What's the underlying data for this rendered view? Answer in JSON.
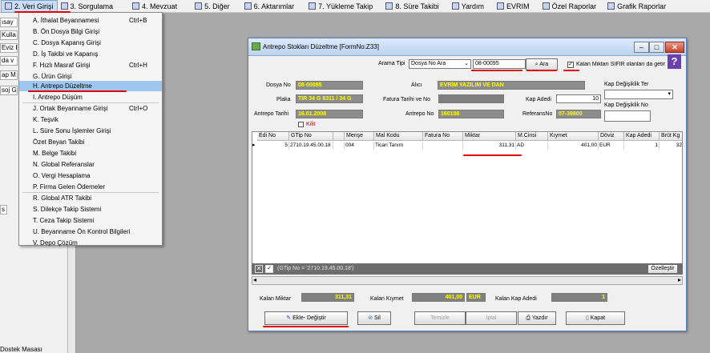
{
  "menubar": [
    {
      "label": "2.  Veri Girişi"
    },
    {
      "label": "3.  Sorgulama"
    },
    {
      "label": "4.  Mevzuat"
    },
    {
      "label": "5.  Diğer"
    },
    {
      "label": "6.  Aktarımlar"
    },
    {
      "label": "7.  Yükleme Takip"
    },
    {
      "label": "8. Süre Takibi"
    },
    {
      "label": "Yardım"
    },
    {
      "label": "EVRIM"
    },
    {
      "label": "Özel Raporlar"
    },
    {
      "label": "Grafik Raporlar"
    }
  ],
  "leftpanel": {
    "rows": [
      "ısay",
      "Kulla",
      "Eviz K",
      "da v",
      "ap M",
      "soj G"
    ],
    "stub1": "s",
    "bottom": "Dostek Masası"
  },
  "dropdown": [
    {
      "label": "A.  İthalat Beyannamesi",
      "shortcut": "Ctrl+B"
    },
    {
      "label": "B.  Ön Dosya Bilgi Girişi",
      "shortcut": ""
    },
    {
      "label": "C.  Dosya Kapanış Girişi",
      "shortcut": ""
    },
    {
      "label": "D.  İş Takibi ve Kapanış",
      "shortcut": ""
    },
    {
      "label": "F.  Hızlı Masraf Girişi",
      "shortcut": "Ctrl+H"
    },
    {
      "label": "G.  Ürün Girişi",
      "shortcut": ""
    },
    {
      "label": "H.  Antrepo Düzeltme",
      "shortcut": ""
    },
    {
      "label": "I.   Antrepo Düşüm",
      "shortcut": ""
    },
    {
      "label": "J.  Ortak Beyanname Girişi",
      "shortcut": "Ctrl+O"
    },
    {
      "label": "K.  Teşvik",
      "shortcut": ""
    },
    {
      "label": "L.   Süre Sonu İşlemler Girişi",
      "shortcut": ""
    },
    {
      "label": "      Özet Beyan Takibi",
      "shortcut": ""
    },
    {
      "label": "M.   Belge Takibi",
      "shortcut": ""
    },
    {
      "label": "N.  Global Referanslar",
      "shortcut": ""
    },
    {
      "label": "O. Vergi Hesaplama",
      "shortcut": ""
    },
    {
      "label": "P. Firma Gelen Ödemeler",
      "shortcut": ""
    },
    {
      "label": "R. Global ATR Takibi",
      "shortcut": ""
    },
    {
      "label": "S. Dilekçe Takip Sistemi",
      "shortcut": ""
    },
    {
      "label": "T. Ceza Takip Sistemi",
      "shortcut": ""
    },
    {
      "label": "U. Beyanname Ön Kontrol Bilgileri",
      "shortcut": ""
    },
    {
      "label": "V. Depo Çözüm",
      "shortcut": ""
    }
  ],
  "window": {
    "title": "Antrepo Stokları Düzeltme  [FormNo:Z33]",
    "arama_tipi_label": "Arama Tipi",
    "arama_tipi_value": "Dosya No Ara",
    "search_value": "08-00095",
    "ara_label": "Ara",
    "kalan_label": "Kalan Miktarı SIFIR olanları da getir",
    "dosya_no_label": "Dosya No",
    "dosya_no": "08-00095",
    "plaka_label": "Plaka",
    "plaka": "TIR 34 G 8311 / 34 G",
    "antrepo_tarihi_label": "Antrepo Tarihi",
    "antrepo_tarihi": "16.01.2008",
    "kilit_label": "Kilit",
    "alici_label": "Alıcı",
    "alici": "EVRİM YAZILIM VE DAN",
    "fatura_label": "Fatura Tarihi ve No",
    "kap_adedi_label": "Kap Adedi",
    "kap_adedi": "10",
    "antrepo_no_label": "Antrepo No",
    "antrepo_no": "160108",
    "referans_label": "ReferansNo",
    "referans_no": "07-39800",
    "kap_ter_label": "Kap Değişiklik Ter",
    "kap_no_label": "Kap Değişiklik No",
    "columns": [
      "Edi No",
      "GTip No",
      "",
      "Menşe",
      "Mal Kodu",
      "Fatura No",
      "Miktar",
      "M.Cinsi",
      "Kıymet",
      "Döviz",
      "Kap Adedi",
      "Brüt Kg"
    ],
    "row": [
      "5",
      "2710.19.45.00.18",
      "",
      "004",
      "Ticari Tanım",
      "",
      "311,31",
      "AD",
      "401,00",
      "EUR",
      "1",
      "32"
    ],
    "gridbar_text": "(GTip No = '2710.19.45.00.18')",
    "ozellestir_label": "Özelleştir",
    "kalan_miktar_label": "Kalan Miktar",
    "kalan_miktar": "311,31",
    "kalan_kiymet_label": "Kalan Kıymet",
    "kalan_kiymet": "401,00",
    "kalan_kiymet_cur": "EUR",
    "kalan_kap_label": "Kalan Kap Adedi",
    "kalan_kap": "1",
    "ekle_label": "Ekle- Değiştir",
    "sil_label": "Sil",
    "temizle_label": "Temizle",
    "iptal_label": "İptal",
    "yazdir_label": "Yazdır",
    "kapat_label": "Kapat"
  }
}
